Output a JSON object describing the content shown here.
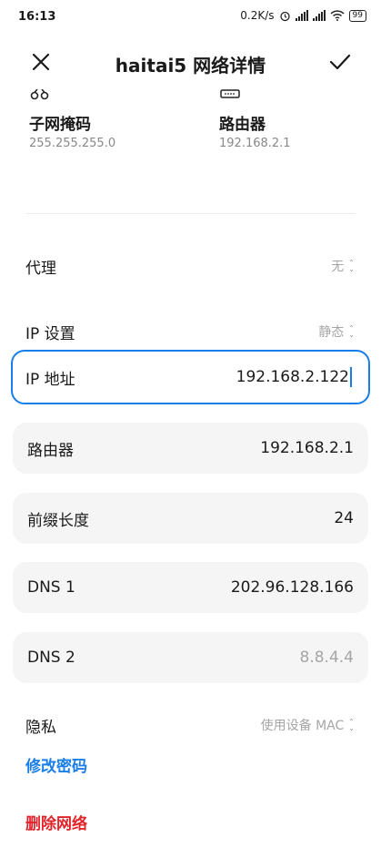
{
  "status_bar": {
    "time": "16:13",
    "speed": "0.2K/s",
    "battery": "99"
  },
  "header": {
    "title": "haitai5 网络详情"
  },
  "info": {
    "subnet_label": "子网掩码",
    "subnet_value": "255.255.255.0",
    "router_label": "路由器",
    "router_value": "192.168.2.1"
  },
  "proxy": {
    "label": "代理",
    "value": "无"
  },
  "ip_settings": {
    "label": "IP 设置",
    "value": "静态"
  },
  "fields": {
    "ip_label": "IP 地址",
    "ip_value": "192.168.2.122",
    "router_label": "路由器",
    "router_value": "192.168.2.1",
    "prefix_label": "前缀长度",
    "prefix_value": "24",
    "dns1_label": "DNS 1",
    "dns1_value": "202.96.128.166",
    "dns2_label": "DNS 2",
    "dns2_placeholder": "8.8.4.4"
  },
  "privacy": {
    "label": "隐私",
    "value": "使用设备 MAC"
  },
  "actions": {
    "modify_password": "修改密码",
    "delete_network": "删除网络"
  },
  "colors": {
    "accent": "#1a7ee8",
    "danger": "#e2232a"
  }
}
